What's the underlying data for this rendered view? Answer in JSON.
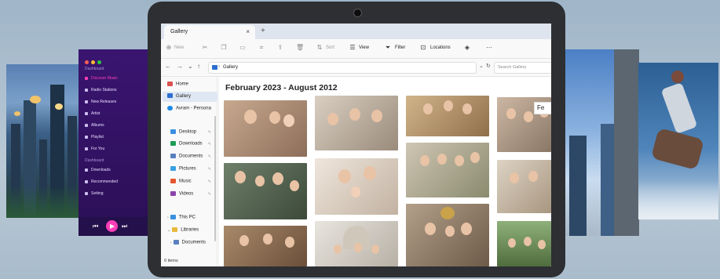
{
  "window": {
    "tab_title": "Gallery",
    "close_glyph": "×",
    "new_tab_glyph": "+"
  },
  "toolbar": {
    "new_label": "New",
    "sort_label": "Sort",
    "view_label": "View",
    "filter_label": "Filter",
    "locations_label": "Locations",
    "more_label": "···"
  },
  "address": {
    "path": "Gallery",
    "separator": "›",
    "search_placeholder": "Search Gallery"
  },
  "sidebar": {
    "items": [
      {
        "label": "Home",
        "icon": "home-icon",
        "color": "#d9534f"
      },
      {
        "label": "Gallery",
        "icon": "gallery-icon",
        "color": "#2c6fd1"
      },
      {
        "label": "Avram - Persona",
        "icon": "cloud-icon",
        "color": "#1e88e5"
      },
      {
        "label": "Desktop",
        "icon": "desktop-icon",
        "color": "#3b8fe0"
      },
      {
        "label": "Downloads",
        "icon": "download-icon",
        "color": "#1f9d55"
      },
      {
        "label": "Documents",
        "icon": "documents-icon",
        "color": "#5a7fbf"
      },
      {
        "label": "Pictures",
        "icon": "pictures-icon",
        "color": "#3aa0e0"
      },
      {
        "label": "Music",
        "icon": "music-icon",
        "color": "#e4572e"
      },
      {
        "label": "Videos",
        "icon": "videos-icon",
        "color": "#8e44ad"
      },
      {
        "label": "This PC",
        "icon": "pc-icon",
        "color": "#3b8fe0"
      },
      {
        "label": "Libraries",
        "icon": "folder-icon",
        "color": "#e8b93c"
      },
      {
        "label": "Documents",
        "icon": "documents-icon",
        "color": "#5a7fbf"
      }
    ],
    "pin_glyph": "📌"
  },
  "status": {
    "items_count": "0 items"
  },
  "main": {
    "date_range_title": "February 2023 - August 2012"
  },
  "tooltip": {
    "text": "Fe"
  },
  "music_app": {
    "sections": [
      {
        "header": "Dashboard",
        "items": [
          "Discover Music",
          "Radio Stations",
          "New Releases",
          "Artist",
          "Albums",
          "Playlist",
          "For You"
        ]
      },
      {
        "header": "Dashboard",
        "items": [
          "Downloads",
          "Recommended",
          "Setting"
        ]
      }
    ],
    "active_color": "#ff3fb8"
  }
}
